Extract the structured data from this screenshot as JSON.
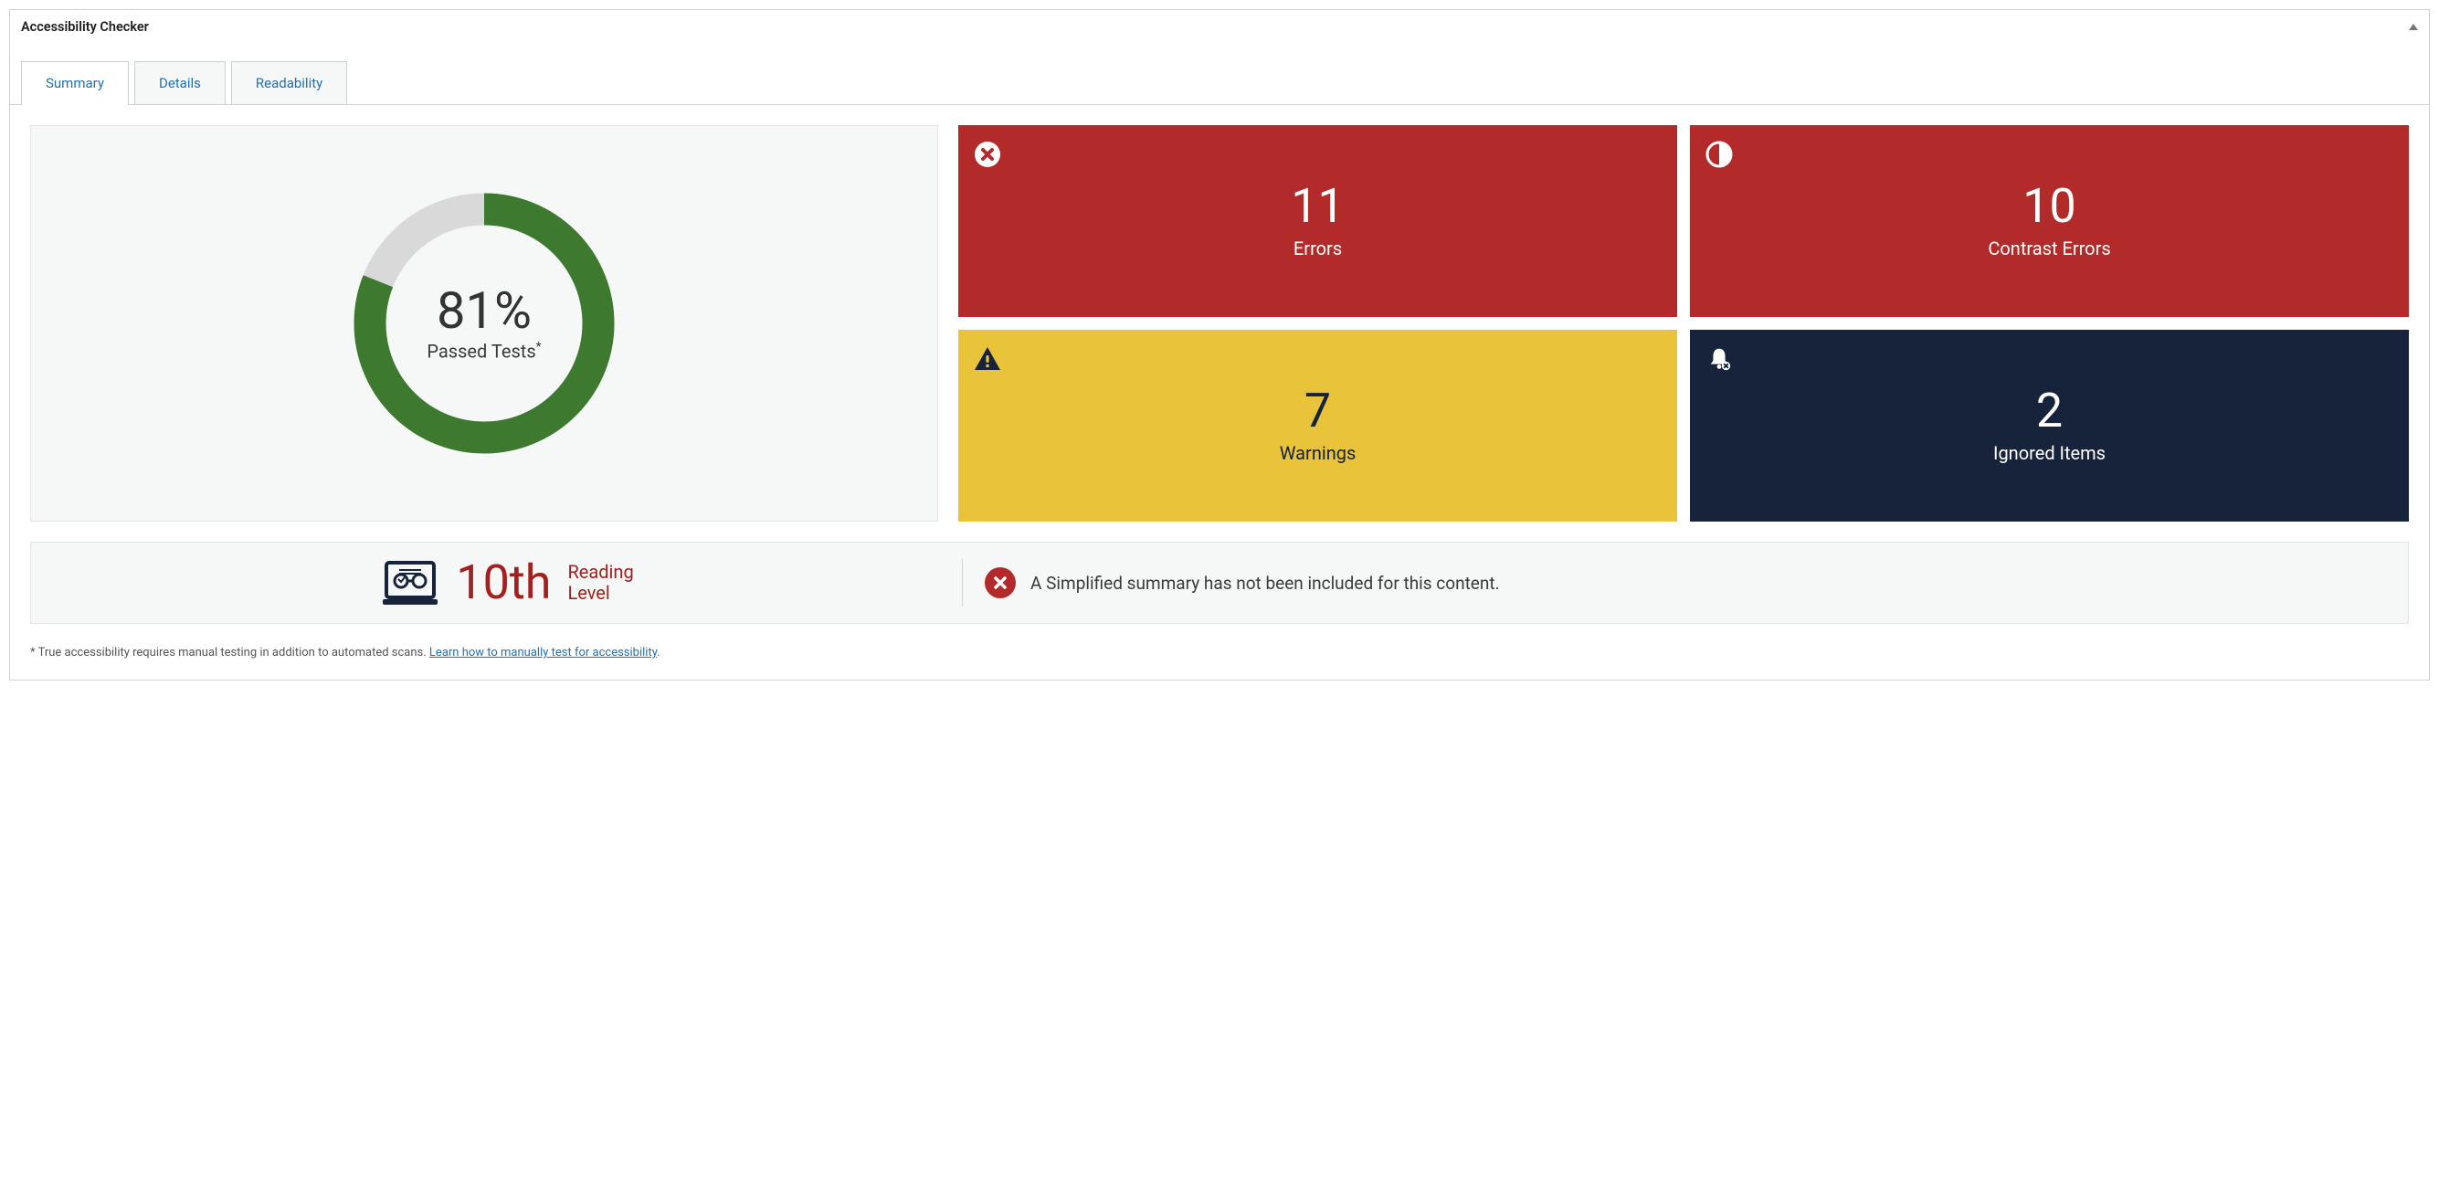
{
  "panel_title": "Accessibility Checker",
  "tabs": [
    {
      "label": "Summary",
      "active": true
    },
    {
      "label": "Details",
      "active": false
    },
    {
      "label": "Readability",
      "active": false
    }
  ],
  "passed": {
    "percent_display": "81%",
    "percent_value": 81,
    "label": "Passed Tests",
    "asterisk": "*"
  },
  "stats": {
    "errors": {
      "count": "11",
      "label": "Errors",
      "icon": "circle-x",
      "bg": "#b22a2a",
      "fg": "#ffffff"
    },
    "contrast": {
      "count": "10",
      "label": "Contrast Errors",
      "icon": "contrast",
      "bg": "#b22a2a",
      "fg": "#ffffff"
    },
    "warnings": {
      "count": "7",
      "label": "Warnings",
      "icon": "warn-tri",
      "bg": "#e9c33a",
      "fg": "#17233a"
    },
    "ignored": {
      "count": "2",
      "label": "Ignored Items",
      "icon": "bell-x",
      "bg": "#17233a",
      "fg": "#ffffff"
    }
  },
  "reading": {
    "grade": "10th",
    "label_line1": "Reading",
    "label_line2": "Level",
    "icon": "readability"
  },
  "summary_status": {
    "icon": "circle-x",
    "message": "A Simplified summary has not been included for this content."
  },
  "footnote": {
    "asterisk": "*",
    "text": " True accessibility requires manual testing in addition to automated scans. ",
    "link_text": "Learn how to manually test for accessibility",
    "period": "."
  },
  "chart_data": {
    "type": "pie",
    "title": "Passed Tests",
    "categories": [
      "Passed",
      "Remaining"
    ],
    "values": [
      81,
      19
    ],
    "colors": [
      "#3d7a2f",
      "#d9d9d9"
    ],
    "center_label": "81%",
    "donut": true
  }
}
